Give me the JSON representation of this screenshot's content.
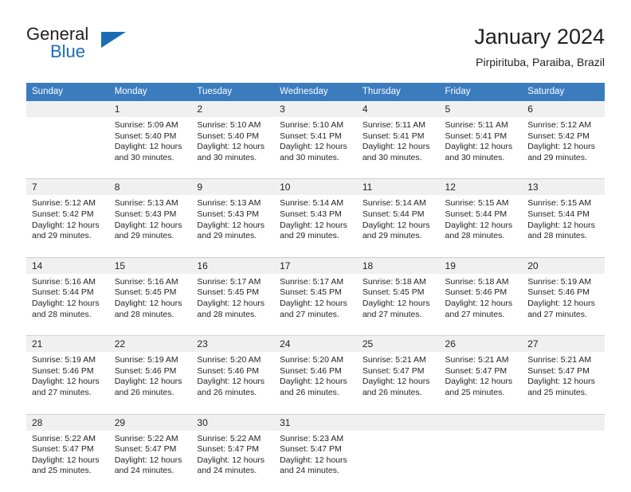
{
  "brand": {
    "name_part1": "General",
    "name_part2": "Blue",
    "triangle_icon": "blue-triangle-logo-mark",
    "accent_color": "#1b6cb5"
  },
  "header": {
    "title": "January 2024",
    "subtitle": "Pirpirituba, Paraiba, Brazil"
  },
  "colors": {
    "header_row_bg": "#3b7cbf",
    "daynum_band_bg": "#f0f0f0",
    "text": "#231f20",
    "separator": "#d0d0d0"
  },
  "weekdays": [
    "Sunday",
    "Monday",
    "Tuesday",
    "Wednesday",
    "Thursday",
    "Friday",
    "Saturday"
  ],
  "weeks": [
    {
      "days": [
        {
          "num": "",
          "sunrise": "",
          "sunset": "",
          "daylight_line1": "",
          "daylight_line2": ""
        },
        {
          "num": "1",
          "sunrise": "Sunrise: 5:09 AM",
          "sunset": "Sunset: 5:40 PM",
          "daylight_line1": "Daylight: 12 hours",
          "daylight_line2": "and 30 minutes."
        },
        {
          "num": "2",
          "sunrise": "Sunrise: 5:10 AM",
          "sunset": "Sunset: 5:40 PM",
          "daylight_line1": "Daylight: 12 hours",
          "daylight_line2": "and 30 minutes."
        },
        {
          "num": "3",
          "sunrise": "Sunrise: 5:10 AM",
          "sunset": "Sunset: 5:41 PM",
          "daylight_line1": "Daylight: 12 hours",
          "daylight_line2": "and 30 minutes."
        },
        {
          "num": "4",
          "sunrise": "Sunrise: 5:11 AM",
          "sunset": "Sunset: 5:41 PM",
          "daylight_line1": "Daylight: 12 hours",
          "daylight_line2": "and 30 minutes."
        },
        {
          "num": "5",
          "sunrise": "Sunrise: 5:11 AM",
          "sunset": "Sunset: 5:41 PM",
          "daylight_line1": "Daylight: 12 hours",
          "daylight_line2": "and 30 minutes."
        },
        {
          "num": "6",
          "sunrise": "Sunrise: 5:12 AM",
          "sunset": "Sunset: 5:42 PM",
          "daylight_line1": "Daylight: 12 hours",
          "daylight_line2": "and 29 minutes."
        }
      ]
    },
    {
      "days": [
        {
          "num": "7",
          "sunrise": "Sunrise: 5:12 AM",
          "sunset": "Sunset: 5:42 PM",
          "daylight_line1": "Daylight: 12 hours",
          "daylight_line2": "and 29 minutes."
        },
        {
          "num": "8",
          "sunrise": "Sunrise: 5:13 AM",
          "sunset": "Sunset: 5:43 PM",
          "daylight_line1": "Daylight: 12 hours",
          "daylight_line2": "and 29 minutes."
        },
        {
          "num": "9",
          "sunrise": "Sunrise: 5:13 AM",
          "sunset": "Sunset: 5:43 PM",
          "daylight_line1": "Daylight: 12 hours",
          "daylight_line2": "and 29 minutes."
        },
        {
          "num": "10",
          "sunrise": "Sunrise: 5:14 AM",
          "sunset": "Sunset: 5:43 PM",
          "daylight_line1": "Daylight: 12 hours",
          "daylight_line2": "and 29 minutes."
        },
        {
          "num": "11",
          "sunrise": "Sunrise: 5:14 AM",
          "sunset": "Sunset: 5:44 PM",
          "daylight_line1": "Daylight: 12 hours",
          "daylight_line2": "and 29 minutes."
        },
        {
          "num": "12",
          "sunrise": "Sunrise: 5:15 AM",
          "sunset": "Sunset: 5:44 PM",
          "daylight_line1": "Daylight: 12 hours",
          "daylight_line2": "and 28 minutes."
        },
        {
          "num": "13",
          "sunrise": "Sunrise: 5:15 AM",
          "sunset": "Sunset: 5:44 PM",
          "daylight_line1": "Daylight: 12 hours",
          "daylight_line2": "and 28 minutes."
        }
      ]
    },
    {
      "days": [
        {
          "num": "14",
          "sunrise": "Sunrise: 5:16 AM",
          "sunset": "Sunset: 5:44 PM",
          "daylight_line1": "Daylight: 12 hours",
          "daylight_line2": "and 28 minutes."
        },
        {
          "num": "15",
          "sunrise": "Sunrise: 5:16 AM",
          "sunset": "Sunset: 5:45 PM",
          "daylight_line1": "Daylight: 12 hours",
          "daylight_line2": "and 28 minutes."
        },
        {
          "num": "16",
          "sunrise": "Sunrise: 5:17 AM",
          "sunset": "Sunset: 5:45 PM",
          "daylight_line1": "Daylight: 12 hours",
          "daylight_line2": "and 28 minutes."
        },
        {
          "num": "17",
          "sunrise": "Sunrise: 5:17 AM",
          "sunset": "Sunset: 5:45 PM",
          "daylight_line1": "Daylight: 12 hours",
          "daylight_line2": "and 27 minutes."
        },
        {
          "num": "18",
          "sunrise": "Sunrise: 5:18 AM",
          "sunset": "Sunset: 5:45 PM",
          "daylight_line1": "Daylight: 12 hours",
          "daylight_line2": "and 27 minutes."
        },
        {
          "num": "19",
          "sunrise": "Sunrise: 5:18 AM",
          "sunset": "Sunset: 5:46 PM",
          "daylight_line1": "Daylight: 12 hours",
          "daylight_line2": "and 27 minutes."
        },
        {
          "num": "20",
          "sunrise": "Sunrise: 5:19 AM",
          "sunset": "Sunset: 5:46 PM",
          "daylight_line1": "Daylight: 12 hours",
          "daylight_line2": "and 27 minutes."
        }
      ]
    },
    {
      "days": [
        {
          "num": "21",
          "sunrise": "Sunrise: 5:19 AM",
          "sunset": "Sunset: 5:46 PM",
          "daylight_line1": "Daylight: 12 hours",
          "daylight_line2": "and 27 minutes."
        },
        {
          "num": "22",
          "sunrise": "Sunrise: 5:19 AM",
          "sunset": "Sunset: 5:46 PM",
          "daylight_line1": "Daylight: 12 hours",
          "daylight_line2": "and 26 minutes."
        },
        {
          "num": "23",
          "sunrise": "Sunrise: 5:20 AM",
          "sunset": "Sunset: 5:46 PM",
          "daylight_line1": "Daylight: 12 hours",
          "daylight_line2": "and 26 minutes."
        },
        {
          "num": "24",
          "sunrise": "Sunrise: 5:20 AM",
          "sunset": "Sunset: 5:46 PM",
          "daylight_line1": "Daylight: 12 hours",
          "daylight_line2": "and 26 minutes."
        },
        {
          "num": "25",
          "sunrise": "Sunrise: 5:21 AM",
          "sunset": "Sunset: 5:47 PM",
          "daylight_line1": "Daylight: 12 hours",
          "daylight_line2": "and 26 minutes."
        },
        {
          "num": "26",
          "sunrise": "Sunrise: 5:21 AM",
          "sunset": "Sunset: 5:47 PM",
          "daylight_line1": "Daylight: 12 hours",
          "daylight_line2": "and 25 minutes."
        },
        {
          "num": "27",
          "sunrise": "Sunrise: 5:21 AM",
          "sunset": "Sunset: 5:47 PM",
          "daylight_line1": "Daylight: 12 hours",
          "daylight_line2": "and 25 minutes."
        }
      ]
    },
    {
      "days": [
        {
          "num": "28",
          "sunrise": "Sunrise: 5:22 AM",
          "sunset": "Sunset: 5:47 PM",
          "daylight_line1": "Daylight: 12 hours",
          "daylight_line2": "and 25 minutes."
        },
        {
          "num": "29",
          "sunrise": "Sunrise: 5:22 AM",
          "sunset": "Sunset: 5:47 PM",
          "daylight_line1": "Daylight: 12 hours",
          "daylight_line2": "and 24 minutes."
        },
        {
          "num": "30",
          "sunrise": "Sunrise: 5:22 AM",
          "sunset": "Sunset: 5:47 PM",
          "daylight_line1": "Daylight: 12 hours",
          "daylight_line2": "and 24 minutes."
        },
        {
          "num": "31",
          "sunrise": "Sunrise: 5:23 AM",
          "sunset": "Sunset: 5:47 PM",
          "daylight_line1": "Daylight: 12 hours",
          "daylight_line2": "and 24 minutes."
        },
        {
          "num": "",
          "sunrise": "",
          "sunset": "",
          "daylight_line1": "",
          "daylight_line2": ""
        },
        {
          "num": "",
          "sunrise": "",
          "sunset": "",
          "daylight_line1": "",
          "daylight_line2": ""
        },
        {
          "num": "",
          "sunrise": "",
          "sunset": "",
          "daylight_line1": "",
          "daylight_line2": ""
        }
      ]
    }
  ]
}
